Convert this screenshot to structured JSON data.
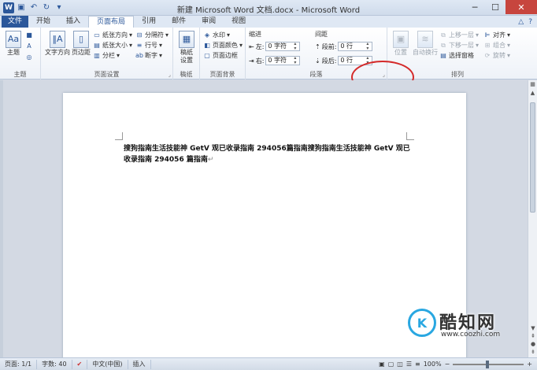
{
  "titlebar": {
    "title": "新建 Microsoft Word 文档.docx - Microsoft Word",
    "app_logo": "W",
    "minimize": "─",
    "maximize": "☐",
    "close": "✕"
  },
  "tabs": {
    "file": "文件",
    "items": [
      "开始",
      "插入",
      "页面布局",
      "引用",
      "邮件",
      "审阅",
      "视图"
    ],
    "active": "页面布局"
  },
  "ribbon": {
    "theme": {
      "label": "主题",
      "group": "主题"
    },
    "page_setup": {
      "group": "页面设置",
      "text_direction": "文字方向",
      "margins": "页边距",
      "orientation": "纸张方向",
      "size": "纸张大小",
      "columns": "分栏",
      "breaks": "分隔符",
      "line_numbers": "行号",
      "hyphenation": "断字"
    },
    "draft": {
      "label": "稿纸设置",
      "group": "稿纸"
    },
    "page_background": {
      "group": "页面背景",
      "watermark": "水印",
      "page_color": "页面颜色",
      "page_borders": "页面边框"
    },
    "paragraph": {
      "group": "段落",
      "indent_label": "缩进",
      "spacing_label": "间距",
      "left_label": "左:",
      "left_value": "0 字符",
      "right_label": "右:",
      "right_value": "0 字符",
      "before_label": "段前:",
      "before_value": "0 行",
      "after_label": "段后:",
      "after_value": "0 行"
    },
    "arrange": {
      "group": "排列",
      "position": "位置",
      "wrap_text": "自动换行",
      "bring_forward": "上移一层",
      "send_backward": "下移一层",
      "selection_pane": "选择窗格",
      "align": "对齐",
      "group_btn": "组合",
      "rotate": "旋转"
    }
  },
  "document": {
    "text": "搜狗指南生活技能神  GetV 观已收录指南 294056篇指南搜狗指南生活技能神  GetV 观已收录指南 294056 篇指南",
    "paragraph_mark": "↵"
  },
  "statusbar": {
    "page": "页面: 1/1",
    "words": "字数: 40",
    "language": "中文(中国)",
    "mode": "插入",
    "zoom": "100%"
  },
  "watermark": {
    "logo_letter": "K",
    "name": "酷知网",
    "url": "www.coozhi.com"
  },
  "colors": {
    "accent": "#2b579a",
    "annotation": "#d42a2a"
  }
}
